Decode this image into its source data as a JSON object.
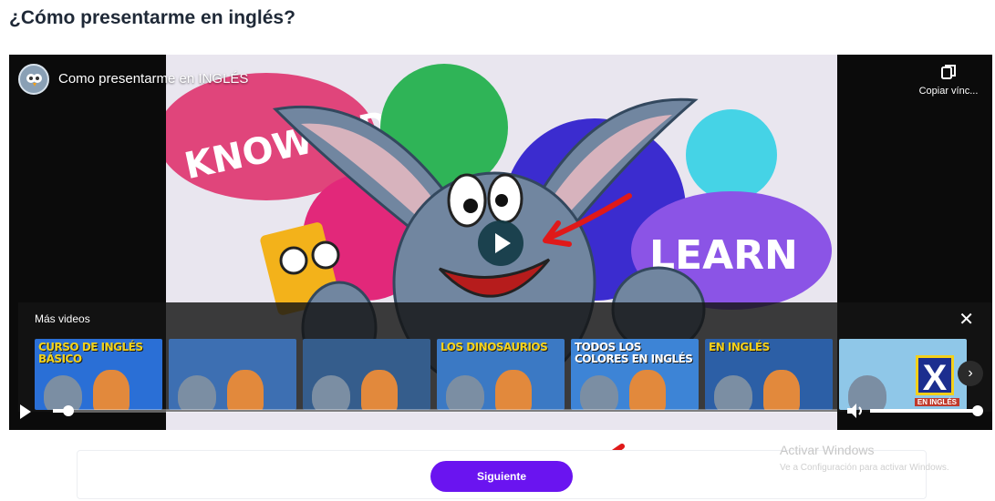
{
  "page": {
    "title": "¿Cómo presentarme en inglés?"
  },
  "player": {
    "video_title": "Como presentarme en INGLÉS",
    "channel_avatar": "owl-avatar",
    "copy_link_label": "Copiar vínc...",
    "thumbnail_text": {
      "left": "KNOWLEDGE",
      "right": "LEARN"
    },
    "progress_fraction": 0.02,
    "volume_fraction": 1.0
  },
  "more_videos": {
    "title": "Más videos",
    "close_icon": "close-icon",
    "next_icon": "chevron-right-icon",
    "cards": [
      {
        "text": "CURSO DE INGLÉS BÁSICO",
        "color": "#f2d21b",
        "bg": "#2a6fd6"
      },
      {
        "text": "",
        "color": "#ffd43b",
        "bg": "#3d6fb2"
      },
      {
        "text": "",
        "color": "#f5e64a",
        "bg": "#355d8c"
      },
      {
        "text": "LOS DINOSAURIOS",
        "color": "#f6d31c",
        "bg": "#3b79c4"
      },
      {
        "text": "TODOS LOS COLORES EN INGLÉS",
        "color": "#ffffff",
        "bg": "#3d84d6"
      },
      {
        "text": "EN INGLÉS",
        "color": "#f4d01a",
        "bg": "#2c5fa6"
      },
      {
        "text": "",
        "color": "#f4d01a",
        "bg": "#8fc7e8",
        "badge": "X",
        "sub": "EN INGLÉS"
      }
    ]
  },
  "controls": {
    "play_icon": "play-icon",
    "volume_icon": "volume-icon"
  },
  "navigation": {
    "next_label": "Siguiente"
  },
  "watermark": {
    "title": "Activar Windows",
    "subtitle": "Ve a Configuración para activar Windows."
  },
  "colors": {
    "accent": "#6a14f0",
    "annotation": "#e01919"
  }
}
